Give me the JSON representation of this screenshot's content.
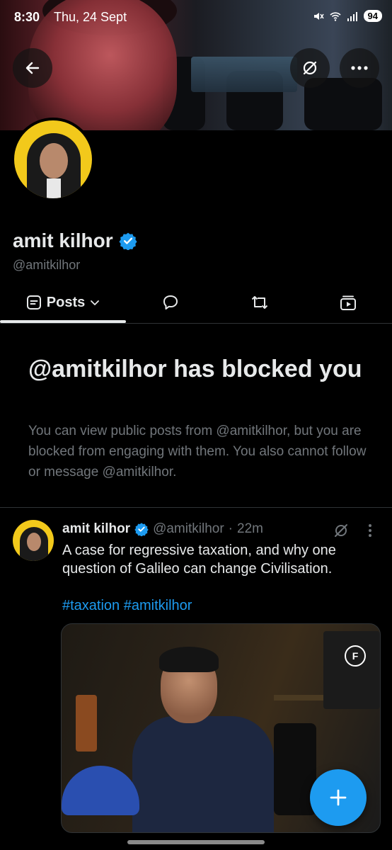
{
  "status_bar": {
    "time": "8:30",
    "date": "Thu, 24 Sept",
    "battery": "94"
  },
  "profile": {
    "name": "amit kilhor",
    "handle": "@amitkilhor"
  },
  "tabs": [
    {
      "label": "Posts",
      "icon": "posts-icon"
    },
    {
      "label": "",
      "icon": "replies-icon"
    },
    {
      "label": "",
      "icon": "reposts-icon"
    },
    {
      "label": "",
      "icon": "media-icon"
    }
  ],
  "blocked": {
    "title": "@amitkilhor has blocked you",
    "text": "You can view public posts from @amitkilhor, but you are blocked from engaging with them. You also cannot follow or message @amitkilhor."
  },
  "post": {
    "name": "amit kilhor",
    "handle": "@amitkilhor",
    "separator": "·",
    "time": "22m",
    "text": "A case for regressive taxation, and why one question of Galileo can change Civilisation.",
    "tags": "#taxation #amitkilhor",
    "media_poster_letter": "F"
  },
  "colors": {
    "accent": "#1d9bf0",
    "verified": "#1d9bf0",
    "muted": "#71767b",
    "background": "#000000"
  }
}
